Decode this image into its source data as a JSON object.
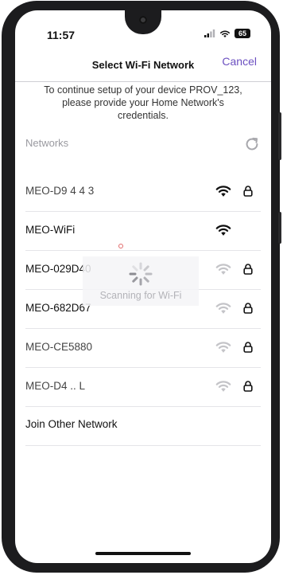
{
  "status_bar": {
    "time": "11:57",
    "battery": "65"
  },
  "header": {
    "title": "Select Wi-Fi Network",
    "cancel_label": "Cancel"
  },
  "intro_text": "To continue setup of your device PROV_123, please provide your Home Network's credentials.",
  "networks_section": {
    "title": "Networks",
    "items": [
      {
        "name": "MEO-D9 4 4 3",
        "signal": "strong",
        "locked": true
      },
      {
        "name": "MEO-WiFi",
        "signal": "strong",
        "locked": false
      },
      {
        "name": "MEO-029D40",
        "signal": "weak",
        "locked": true
      },
      {
        "name": "MEO-682D67",
        "signal": "weak",
        "locked": true
      },
      {
        "name": "MEO-CE5880",
        "signal": "weak",
        "locked": true
      },
      {
        "name": "MEO-D4 .. L",
        "signal": "weak",
        "locked": true
      }
    ],
    "join_other_label": "Join Other Network"
  },
  "scanning_text": "Scanning for Wi-Fi",
  "colors": {
    "accent": "#6b4fc0",
    "wifi_strong": "#111111",
    "wifi_weak": "#c4c4c8"
  }
}
